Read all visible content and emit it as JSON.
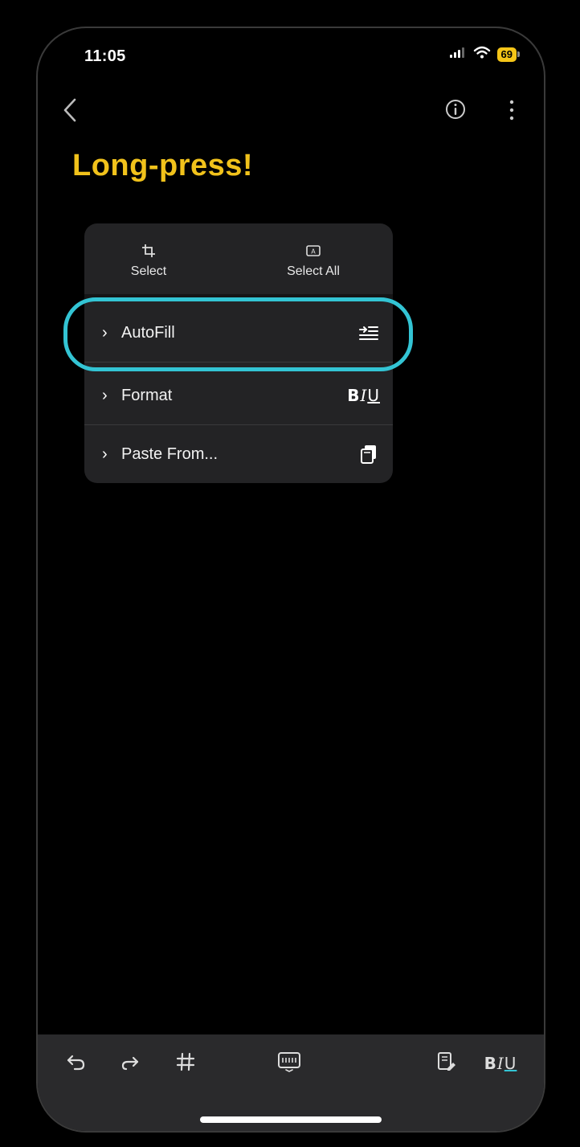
{
  "status_bar": {
    "time": "11:05",
    "battery_level": "69",
    "icons": [
      "cellular-signal-icon",
      "wifi-icon",
      "battery-icon"
    ]
  },
  "nav": {
    "icons": [
      "back-chevron-icon",
      "info-icon",
      "more-vertical-icon"
    ]
  },
  "note": {
    "title": "Long-press!"
  },
  "context_menu": {
    "top_actions": [
      {
        "label": "Select",
        "icon": "select-crop-icon"
      },
      {
        "label": "Select All",
        "icon": "select-all-icon"
      }
    ],
    "items": [
      {
        "label": "AutoFill",
        "icon": "autofill-icon",
        "highlighted": true
      },
      {
        "label": "Format",
        "icon": "bold-italic-underline-icon",
        "icon_text": {
          "b": "B",
          "i": "I",
          "u": "U"
        }
      },
      {
        "label": "Paste From...",
        "icon": "paste-from-icon"
      }
    ]
  },
  "toolbar": {
    "items": [
      "undo-icon",
      "redo-icon",
      "hashtag-icon",
      "keyboard-icon",
      "note-edit-icon",
      "text-format-icon"
    ],
    "format_text": {
      "b": "B",
      "i": "I",
      "u": "U"
    }
  },
  "colors": {
    "title": "#f1c21b",
    "highlight_ring": "#33c4d4",
    "battery": "#f5c518",
    "menu_bg": "#232325",
    "toolbar_bg": "#2a2a2c"
  }
}
